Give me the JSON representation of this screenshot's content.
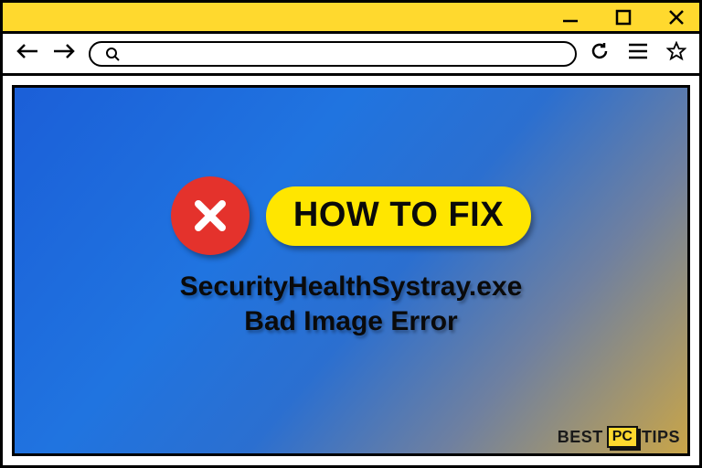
{
  "titlebar": {
    "minimize_icon": "minimize",
    "maximize_icon": "maximize",
    "close_icon": "close"
  },
  "toolbar": {
    "back_icon": "back",
    "forward_icon": "forward",
    "search_icon": "search",
    "refresh_icon": "refresh",
    "menu_icon": "menu",
    "star_icon": "favorite",
    "search_placeholder": ""
  },
  "content": {
    "error_icon": "error-x",
    "pill_label": "HOW TO FIX",
    "line1": "SecurityHealthSystray.exe",
    "line2": "Bad Image Error"
  },
  "watermark": {
    "left": "BEST",
    "mid": "PC",
    "right": "TIPS"
  },
  "colors": {
    "accent_yellow": "#ffd92e",
    "error_red": "#e4322c",
    "pill_yellow": "#ffe600"
  }
}
